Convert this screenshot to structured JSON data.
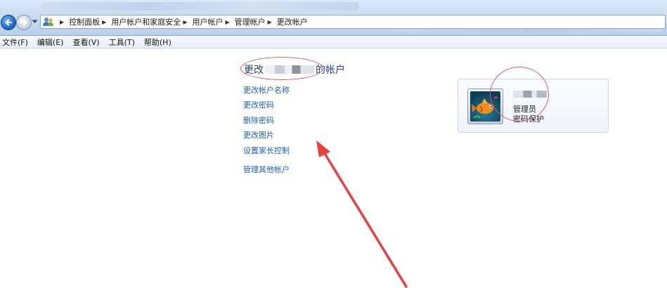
{
  "breadcrumbs": [
    "控制面板",
    "用户帐户和家庭安全",
    "用户帐户",
    "管理帐户",
    "更改帐户"
  ],
  "menu": [
    "文件(F)",
    "编辑(E)",
    "查看(V)",
    "工具(T)",
    "帮助(H)"
  ],
  "page": {
    "title_prefix": "更改",
    "title_suffix": "的帐户"
  },
  "tasks": [
    "更改帐户名称",
    "更改密码",
    "删除密码",
    "更改图片",
    "设置家长控制",
    "管理其他帐户"
  ],
  "user": {
    "role": "管理员",
    "password_status": "密码保护"
  },
  "colors": {
    "link": "#1f5fb4",
    "title": "#1f3f7f",
    "annotation_red": "#e05a5a"
  },
  "icons": [
    "back-arrow-icon",
    "forward-arrow-icon",
    "history-dropdown-icon",
    "control-panel-users-icon",
    "breadcrumb-chevron-icon"
  ]
}
